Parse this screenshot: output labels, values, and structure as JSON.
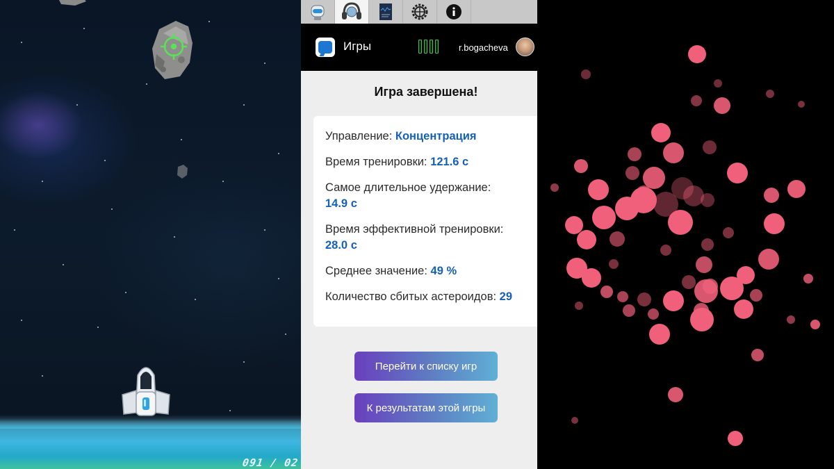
{
  "game": {
    "counter": "091 / 02"
  },
  "tabs": [
    {
      "name": "profile",
      "icon": "robot-head-icon"
    },
    {
      "name": "neuro",
      "icon": "headphones-icon"
    },
    {
      "name": "report",
      "icon": "document-icon"
    },
    {
      "name": "settings",
      "icon": "gear-icon"
    },
    {
      "name": "info",
      "icon": "info-icon"
    }
  ],
  "header": {
    "title": "Игры",
    "username": "r.bogacheva"
  },
  "result": {
    "title": "Игра завершена!",
    "stats": {
      "control_label": "Управление: ",
      "control_value": "Концентрация",
      "time_label": "Время тренировки: ",
      "time_value": "121.6 с",
      "hold_label": "Самое длительное удержание:",
      "hold_value": "14.9 с",
      "effective_label": "Время эффективной тренировки:",
      "effective_value": "28.0 с",
      "average_label": "Среднее значение: ",
      "average_value": "49 %",
      "asteroids_label": "Количество сбитых астероидов: ",
      "asteroids_value": "29"
    },
    "buttons": {
      "games_list": "Перейти к списку игр",
      "game_results": "К результатам этой игры"
    }
  },
  "colors": {
    "accent_value": "#1560b8",
    "button_gradient_start": "#6a3fbe",
    "button_gradient_end": "#5fb0d4",
    "bubble": "#f0607a"
  }
}
